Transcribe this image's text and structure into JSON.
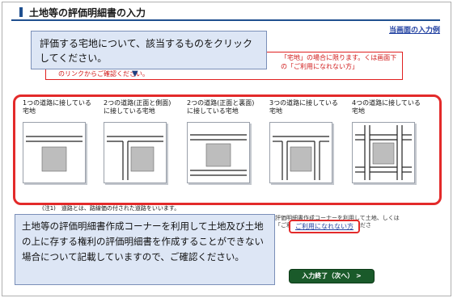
{
  "page": {
    "title": "土地等の評価明細書の入力",
    "example_link": "当画面の入力例"
  },
  "callout_top": {
    "text": "評価する宅地について、該当するものをクリックしてください。"
  },
  "notice": {
    "right_text": "「宅地」の場合に限ります。くは画面下の「ご利用になれない方」",
    "left_text": "のリンクからご確認ください。"
  },
  "options": [
    {
      "label": "1つの道路に接している宅地",
      "icon": "one-road-lot-icon"
    },
    {
      "label": "2つの道路(正面と側面)に接している宅地",
      "icon": "front-side-roads-lot-icon"
    },
    {
      "label": "2つの道路(正面と裏面)に接している宅地",
      "icon": "front-back-roads-lot-icon"
    },
    {
      "label": "3つの道路に接している宅地",
      "icon": "three-roads-lot-icon"
    },
    {
      "label": "4つの道路に接している宅地",
      "icon": "four-roads-lot-icon"
    }
  ],
  "footnote": "(注1)　道路とは、路線価の付された道路をいいます。",
  "callout_bottom": {
    "text": "土地等の評価明細書作成コーナーを利用して土地及び土地の上に存する権利の評価明細書を作成することができない場合について記載していますので、ご確認ください。"
  },
  "side_text": "評価明細書作成コーナーを利用して土地、しくは「ご利用になれない方」をご確認ださ",
  "usage_link": "ご利用になれない方",
  "next_button": "入力終了（次へ） >",
  "colors": {
    "accent_red": "#e32a2a",
    "callout_bg": "#dde6f5",
    "button_green": "#1a5a2a",
    "title_blue": "#1f4f8f"
  }
}
